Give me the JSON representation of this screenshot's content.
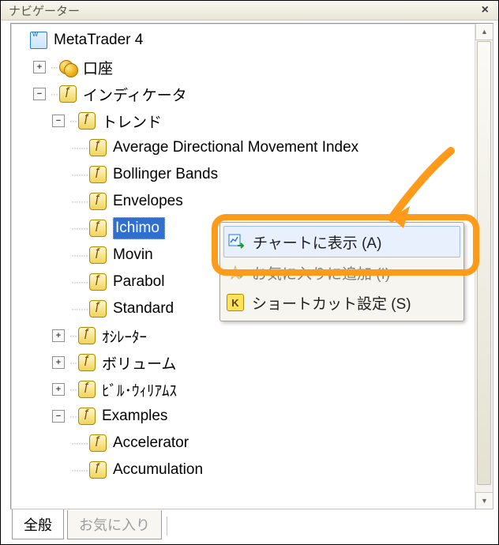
{
  "titlebar": {
    "title": "ナビゲーター",
    "close": "×"
  },
  "root_label": "MetaTrader 4",
  "tree": {
    "account": "口座",
    "indicators": "インディケータ",
    "trend": "トレンド",
    "trend_items": [
      "Average Directional Movement Index",
      "Bollinger Bands",
      "Envelopes",
      "Ichimoku Kinko Hyo",
      "Moving Average",
      "Parabolic SAR",
      "Standard Deviation"
    ],
    "selected_partial": "Ichimo",
    "moving_partial": "Movin",
    "parabolic_partial": "Parabol",
    "standard_partial": "Standard",
    "oscillator": "ｵｼﾚｰﾀｰ",
    "volume": "ボリューム",
    "bill_williams": "ﾋﾞﾙ･ｳｨﾘｱﾑｽ",
    "examples": "Examples",
    "examples_items": [
      "Accelerator",
      "Accumulation"
    ]
  },
  "context_menu": {
    "attach": "チャートに表示 (A)",
    "favorite": "お気に入りに追加 (F)",
    "favorite_partial": "お気に入りに追加 (I)",
    "shortcut": "ショートカット設定 (S)"
  },
  "tabs": {
    "general": "全般",
    "favorites": "お気に入り"
  },
  "icons": {
    "plus": "+",
    "minus": "−"
  },
  "scroll": {
    "up": "▲",
    "down": "▼"
  }
}
